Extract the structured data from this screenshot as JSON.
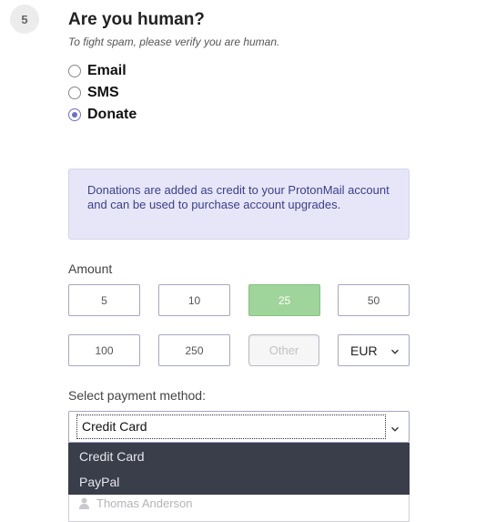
{
  "step": {
    "number": "5"
  },
  "header": {
    "title": "Are you human?",
    "subtitle": "To fight spam, please verify you are human."
  },
  "verification_options": [
    {
      "label": "Email",
      "checked": false
    },
    {
      "label": "SMS",
      "checked": false
    },
    {
      "label": "Donate",
      "checked": true
    }
  ],
  "info": {
    "text": "Donations are added as credit to your ProtonMail account and can be used to purchase account upgrades."
  },
  "amount": {
    "label": "Amount",
    "options": [
      "5",
      "10",
      "25",
      "50",
      "100",
      "250"
    ],
    "selected": "25",
    "other_placeholder": "Other",
    "currency": "EUR"
  },
  "payment": {
    "label": "Select payment method:",
    "selected": "Credit Card",
    "options": [
      "Credit Card",
      "PayPal"
    ]
  },
  "card_name": {
    "placeholder": "Thomas Anderson"
  },
  "colors": {
    "accent": "#6e6ec8",
    "selected_amount": "#9fd49a",
    "info_bg": "#e6e6f8",
    "dropdown_bg": "#3a3d4a"
  }
}
